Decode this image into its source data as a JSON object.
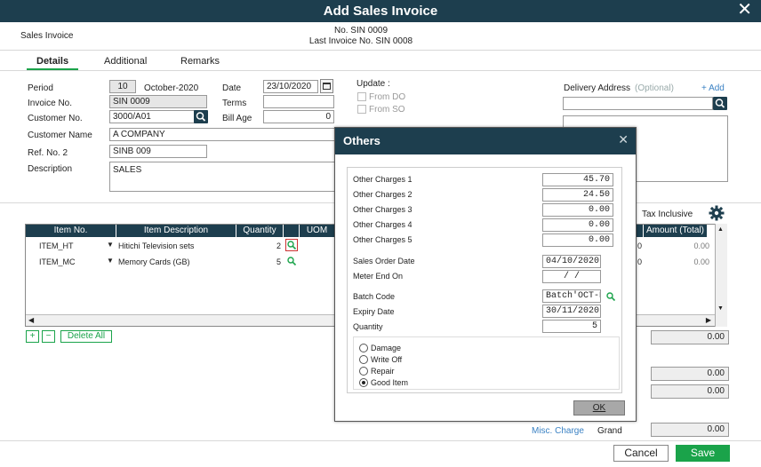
{
  "window": {
    "title": "Add Sales Invoice"
  },
  "doc": {
    "type_label": "Sales Invoice",
    "number": "No. SIN 0009",
    "last_number": "Last Invoice No. SIN 0008"
  },
  "tabs": [
    "Details",
    "Additional",
    "Remarks"
  ],
  "form": {
    "period_label": "Period",
    "period_num": "10",
    "period_name": "October-2020",
    "date_label": "Date",
    "date_value": "23/10/2020",
    "invoice_no_label": "Invoice No.",
    "invoice_no": "SIN 0009",
    "terms_label": "Terms",
    "terms_value": "",
    "customer_no_label": "Customer No.",
    "customer_no": "3000/A01",
    "bill_age_label": "Bill Age",
    "bill_age": "0",
    "customer_name_label": "Customer Name",
    "customer_name": "A COMPANY",
    "ref_no_label": "Ref. No. 2",
    "ref_no": "SINB 009",
    "description_label": "Description",
    "description": "SALES"
  },
  "update": {
    "label": "Update :",
    "from_do": "From DO",
    "from_so": "From SO"
  },
  "delivery": {
    "label": "Delivery Address",
    "optional": "(Optional)",
    "add": "+ Add"
  },
  "grid": {
    "tax_inclusive": "Tax Inclusive",
    "headers": {
      "item_no": "Item No.",
      "item_desc": "Item Description",
      "quantity": "Quantity",
      "uom": "UOM",
      "amount": "Amount (Total)"
    },
    "rows": [
      {
        "item_no": "ITEM_HT",
        "desc": "Hitichi Television sets",
        "qty": "2",
        "mid": "0",
        "amount": "0.00"
      },
      {
        "item_no": "ITEM_MC",
        "desc": "Memory Cards  (GB)",
        "qty": "5",
        "mid": "0",
        "amount": "0.00"
      }
    ],
    "add_symbol": "+",
    "remove_symbol": "−",
    "delete_all": "Delete All"
  },
  "totals": [
    "0.00",
    "0.00",
    "0.00",
    "0.00"
  ],
  "misc_charge": "Misc. Charge",
  "grand_label": "Grand",
  "buttons": {
    "cancel": "Cancel",
    "save": "Save"
  },
  "modal": {
    "title": "Others",
    "charges": [
      {
        "label": "Other Charges 1",
        "value": "45.70"
      },
      {
        "label": "Other Charges 2",
        "value": "24.50"
      },
      {
        "label": "Other Charges 3",
        "value": "0.00"
      },
      {
        "label": "Other Charges 4",
        "value": "0.00"
      },
      {
        "label": "Other Charges 5",
        "value": "0.00"
      }
    ],
    "sales_order_date_label": "Sales Order Date",
    "sales_order_date": "04/10/2020",
    "meter_end_label": "Meter End On",
    "meter_end": "/  /",
    "batch_code_label": "Batch Code",
    "batch_code": "Batch'OCT-N",
    "expiry_label": "Expiry Date",
    "expiry": "30/11/2020",
    "quantity_label": "Quantity",
    "quantity": "5",
    "options": [
      "Damage",
      "Write Off",
      "Repair",
      "Good Item"
    ],
    "selected_option": "Good Item",
    "ok": "OK"
  },
  "colors": {
    "header": "#1d3e4e",
    "accent": "#1aa34a",
    "link": "#3b82c4"
  }
}
